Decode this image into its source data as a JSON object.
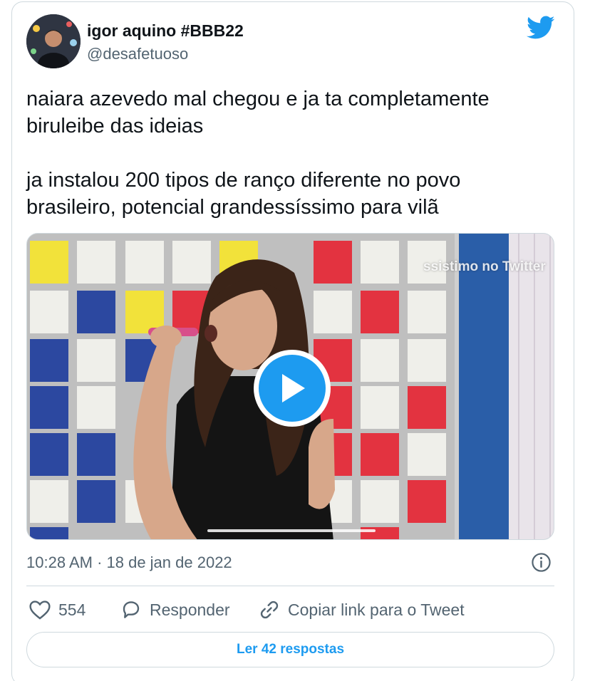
{
  "tweet": {
    "author": {
      "display_name": "igor aquino #BBB22",
      "handle": "@desafetuoso",
      "avatar_icon": "profile-photo"
    },
    "text_paragraphs": [
      "naiara azevedo mal chegou e ja ta completamente biruleibe das ideias",
      "ja instalou 200 tipos de ranço diferente no povo brasileiro, potencial grandessíssimo para vilã"
    ],
    "media": {
      "type": "video",
      "watermark": "ssistimo no Twitter",
      "play_icon": "play-icon"
    },
    "timestamp": "10:28 AM · 18 de jan de 2022",
    "actions": {
      "like_count": "554",
      "reply_label": "Responder",
      "copy_link_label": "Copiar link para o Tweet"
    },
    "read_replies_label": "Ler 42 respostas"
  },
  "colors": {
    "accent": "#1d9bf0",
    "secondary_text": "#536471",
    "primary_text": "#0f1419",
    "border": "#cfd9de"
  }
}
